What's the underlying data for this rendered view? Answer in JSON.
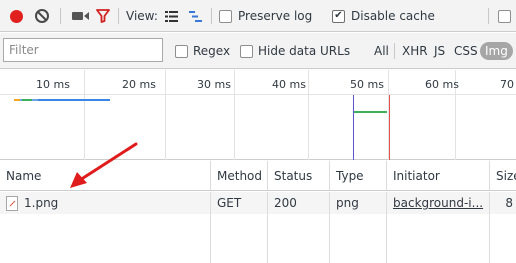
{
  "toolbar": {
    "record_icon": "record-icon",
    "clear_icon": "clear-icon",
    "capture_icon": "camera-icon",
    "filter_icon": "filter-icon",
    "view_label": "View:",
    "view_large_icon": "list-view-icon",
    "view_waterfall_icon": "waterfall-view-icon",
    "preserve_log_label": "Preserve log",
    "preserve_log_checked": false,
    "disable_cache_label": "Disable cache",
    "disable_cache_checked": true,
    "record_color": "#e0201e",
    "filter_color": "#d22020"
  },
  "filterbar": {
    "placeholder": "Filter",
    "regex_label": "Regex",
    "hide_data_urls_label": "Hide data URLs",
    "types": [
      "All",
      "XHR",
      "JS",
      "CSS",
      "Img"
    ],
    "active_type": "Img"
  },
  "overview": {
    "ticks": [
      "10 ms",
      "20 ms",
      "30 ms",
      "40 ms",
      "50 ms",
      "60 ms",
      "70"
    ]
  },
  "grid": {
    "headers": [
      "Name",
      "Method",
      "Status",
      "Type",
      "Initiator",
      "Size"
    ],
    "rows": [
      {
        "name": "1.png",
        "method": "GET",
        "status": "200",
        "type": "png",
        "initiator": "background-i...",
        "size": "8"
      }
    ]
  }
}
